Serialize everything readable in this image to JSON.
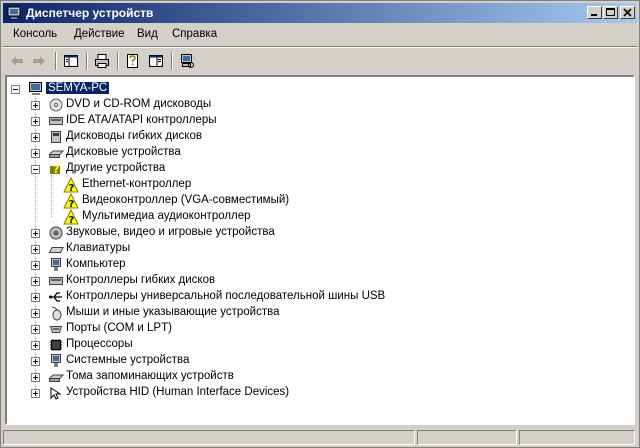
{
  "window": {
    "title": "Диспетчер устройств",
    "caption_buttons": [
      "minimize",
      "maximize",
      "close"
    ]
  },
  "menu": [
    "Консоль",
    "Действие",
    "Вид",
    "Справка"
  ],
  "toolbar": {
    "buttons": [
      "back-icon",
      "forward-icon",
      "show-hide-tree-icon",
      "print-icon",
      "properties-icon",
      "help-icon",
      "scan-hardware-icon"
    ]
  },
  "tree": {
    "root": "SEMYA-PC",
    "categories": [
      {
        "label": "DVD и CD-ROM дисководы",
        "icon": "cdrom-icon",
        "expanded": false
      },
      {
        "label": "IDE ATA/ATAPI контроллеры",
        "icon": "ide-controller-icon",
        "expanded": false
      },
      {
        "label": "Дисководы гибких дисков",
        "icon": "floppy-drive-icon",
        "expanded": false
      },
      {
        "label": "Дисковые устройства",
        "icon": "disk-drive-icon",
        "expanded": false
      },
      {
        "label": "Другие устройства",
        "icon": "unknown-device-icon",
        "expanded": true,
        "children": [
          {
            "label": "Ethernet-контроллер",
            "icon": "unknown-device-warning-icon"
          },
          {
            "label": "Видеоконтроллер (VGA-совместимый)",
            "icon": "unknown-device-warning-icon"
          },
          {
            "label": "Мультимедиа аудиоконтроллер",
            "icon": "unknown-device-warning-icon"
          }
        ]
      },
      {
        "label": "Звуковые, видео и игровые устройства",
        "icon": "sound-icon",
        "expanded": false
      },
      {
        "label": "Клавиатуры",
        "icon": "keyboard-icon",
        "expanded": false
      },
      {
        "label": "Компьютер",
        "icon": "computer-icon",
        "expanded": false
      },
      {
        "label": "Контроллеры гибких дисков",
        "icon": "floppy-controller-icon",
        "expanded": false
      },
      {
        "label": "Контроллеры универсальной последовательной шины USB",
        "icon": "usb-icon",
        "expanded": false
      },
      {
        "label": "Мыши и иные указывающие устройства",
        "icon": "mouse-icon",
        "expanded": false
      },
      {
        "label": "Порты (COM и LPT)",
        "icon": "port-icon",
        "expanded": false
      },
      {
        "label": "Процессоры",
        "icon": "processor-icon",
        "expanded": false
      },
      {
        "label": "Системные устройства",
        "icon": "system-device-icon",
        "expanded": false
      },
      {
        "label": "Тома запоминающих устройств",
        "icon": "storage-volume-icon",
        "expanded": false
      },
      {
        "label": "Устройства HID (Human Interface Devices)",
        "icon": "hid-icon",
        "expanded": false
      }
    ]
  }
}
